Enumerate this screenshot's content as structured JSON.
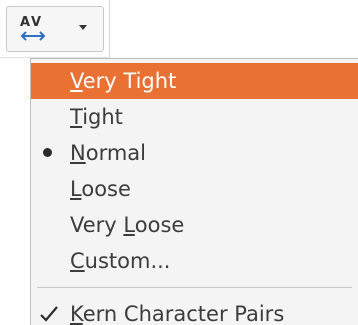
{
  "toolbar": {
    "button_icon": "character-spacing-icon",
    "dropdown_icon": "chevron-down-icon"
  },
  "menu": {
    "highlight_color": "#ea7134",
    "items": [
      {
        "pre": "",
        "mnemonic": "V",
        "post": "ery Tight",
        "state": "highlighted"
      },
      {
        "pre": "",
        "mnemonic": "T",
        "post": "ight",
        "state": ""
      },
      {
        "pre": "",
        "mnemonic": "N",
        "post": "ormal",
        "state": "selected"
      },
      {
        "pre": "",
        "mnemonic": "L",
        "post": "oose",
        "state": ""
      },
      {
        "pre": "Very ",
        "mnemonic": "L",
        "post": "oose",
        "state": ""
      },
      {
        "pre": "",
        "mnemonic": "C",
        "post": "ustom...",
        "state": ""
      }
    ],
    "kern": {
      "pre": "",
      "mnemonic": "K",
      "post": "ern Character Pairs",
      "checked": true
    }
  }
}
